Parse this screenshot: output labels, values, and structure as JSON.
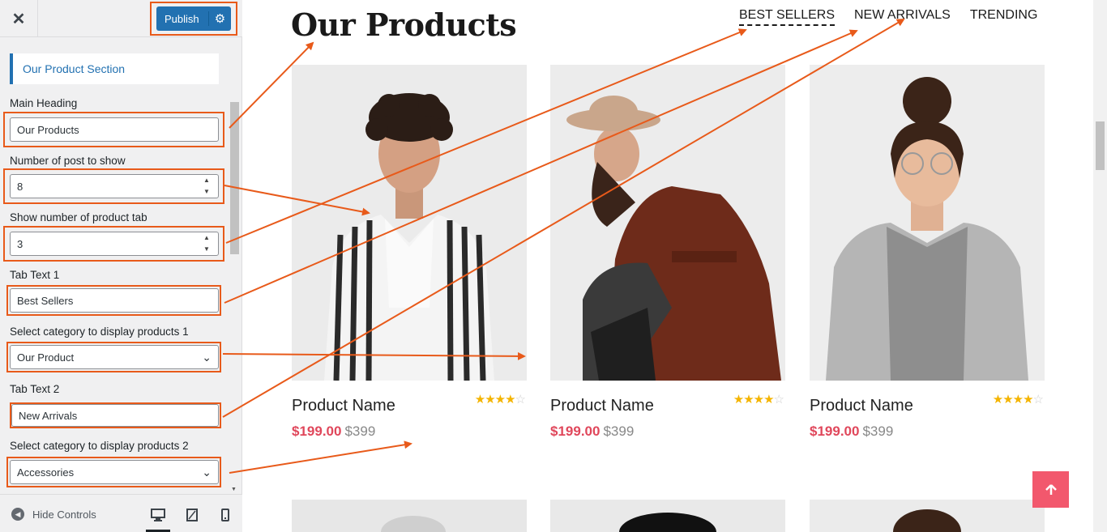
{
  "customizer": {
    "close_glyph": "✕",
    "publish_label": "Publish",
    "section_title": "Our Product Section",
    "controls": {
      "main_heading": {
        "label": "Main Heading",
        "value": "Our Products"
      },
      "posts_to_show": {
        "label": "Number of post to show",
        "value": "8"
      },
      "tab_count": {
        "label": "Show number of product tab",
        "value": "3"
      },
      "tab_text_1": {
        "label": "Tab Text 1",
        "value": "Best Sellers"
      },
      "category_1": {
        "label": "Select category to display products 1",
        "value": "Our Product"
      },
      "tab_text_2": {
        "label": "Tab Text 2",
        "value": "New Arrivals"
      },
      "category_2": {
        "label": "Select category to display products 2",
        "value": "Accessories"
      }
    },
    "hide_controls_label": "Hide Controls"
  },
  "preview": {
    "heading": "Our Products",
    "tabs": [
      "BEST SELLERS",
      "NEW ARRIVALS",
      "TRENDING"
    ],
    "active_tab": "BEST SELLERS",
    "products": [
      {
        "name": "Product Name",
        "sale_price": "$199.00",
        "regular_price": "$399",
        "rating": 4,
        "max_rating": 5
      },
      {
        "name": "Product Name",
        "sale_price": "$199.00",
        "regular_price": "$399",
        "rating": 4,
        "max_rating": 5
      },
      {
        "name": "Product Name",
        "sale_price": "$199.00",
        "regular_price": "$399",
        "rating": 4,
        "max_rating": 5
      }
    ]
  },
  "colors": {
    "annotation": "#e85a1a",
    "publish": "#2271b1",
    "sale_price": "#e0475b",
    "back_to_top": "#f2586d",
    "stars": "#f4b400"
  },
  "icons": [
    "close-icon",
    "gear-icon",
    "chevron-down-icon",
    "spinner-icon",
    "hide-controls-icon",
    "desktop-icon",
    "tablet-icon",
    "mobile-icon",
    "arrow-up-icon"
  ]
}
